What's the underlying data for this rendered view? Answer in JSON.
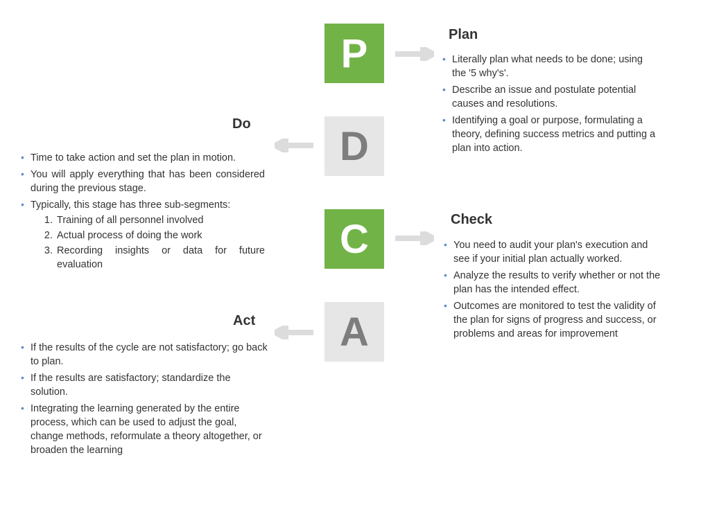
{
  "tiles": {
    "p": "P",
    "d": "D",
    "c": "C",
    "a": "A"
  },
  "sections": {
    "plan": {
      "title": "Plan",
      "bullets": [
        "Literally plan what needs to be done; using the '5 why's'.",
        "Describe an issue and postulate potential causes and resolutions.",
        "Identifying a goal or purpose, formulating a theory, defining success metrics and putting a plan into action."
      ]
    },
    "do": {
      "title": "Do",
      "bullets": [
        "Time to take action and set the plan in motion.",
        "You will apply everything that has been considered during the previous stage.",
        "Typically, this stage has three sub-segments:"
      ],
      "sub": [
        "Training of all personnel involved",
        "Actual process of doing the work",
        "Recording insights or data for future evaluation"
      ]
    },
    "check": {
      "title": "Check",
      "bullets": [
        "You need to audit your plan's execution and see if your initial plan actually worked.",
        "Analyze the results to verify whether or not the plan has the intended effect.",
        "Outcomes are monitored to test the validity of the plan for signs of progress and success, or problems and areas for improvement"
      ]
    },
    "act": {
      "title": "Act",
      "bullets": [
        "If the results of the cycle are not satisfactory; go back to plan.",
        "If the results are satisfactory; standardize the solution.",
        "Integrating the learning generated by the entire process, which can be used to adjust the goal, change methods, reformulate a theory altogether, or broaden the learning"
      ]
    }
  }
}
